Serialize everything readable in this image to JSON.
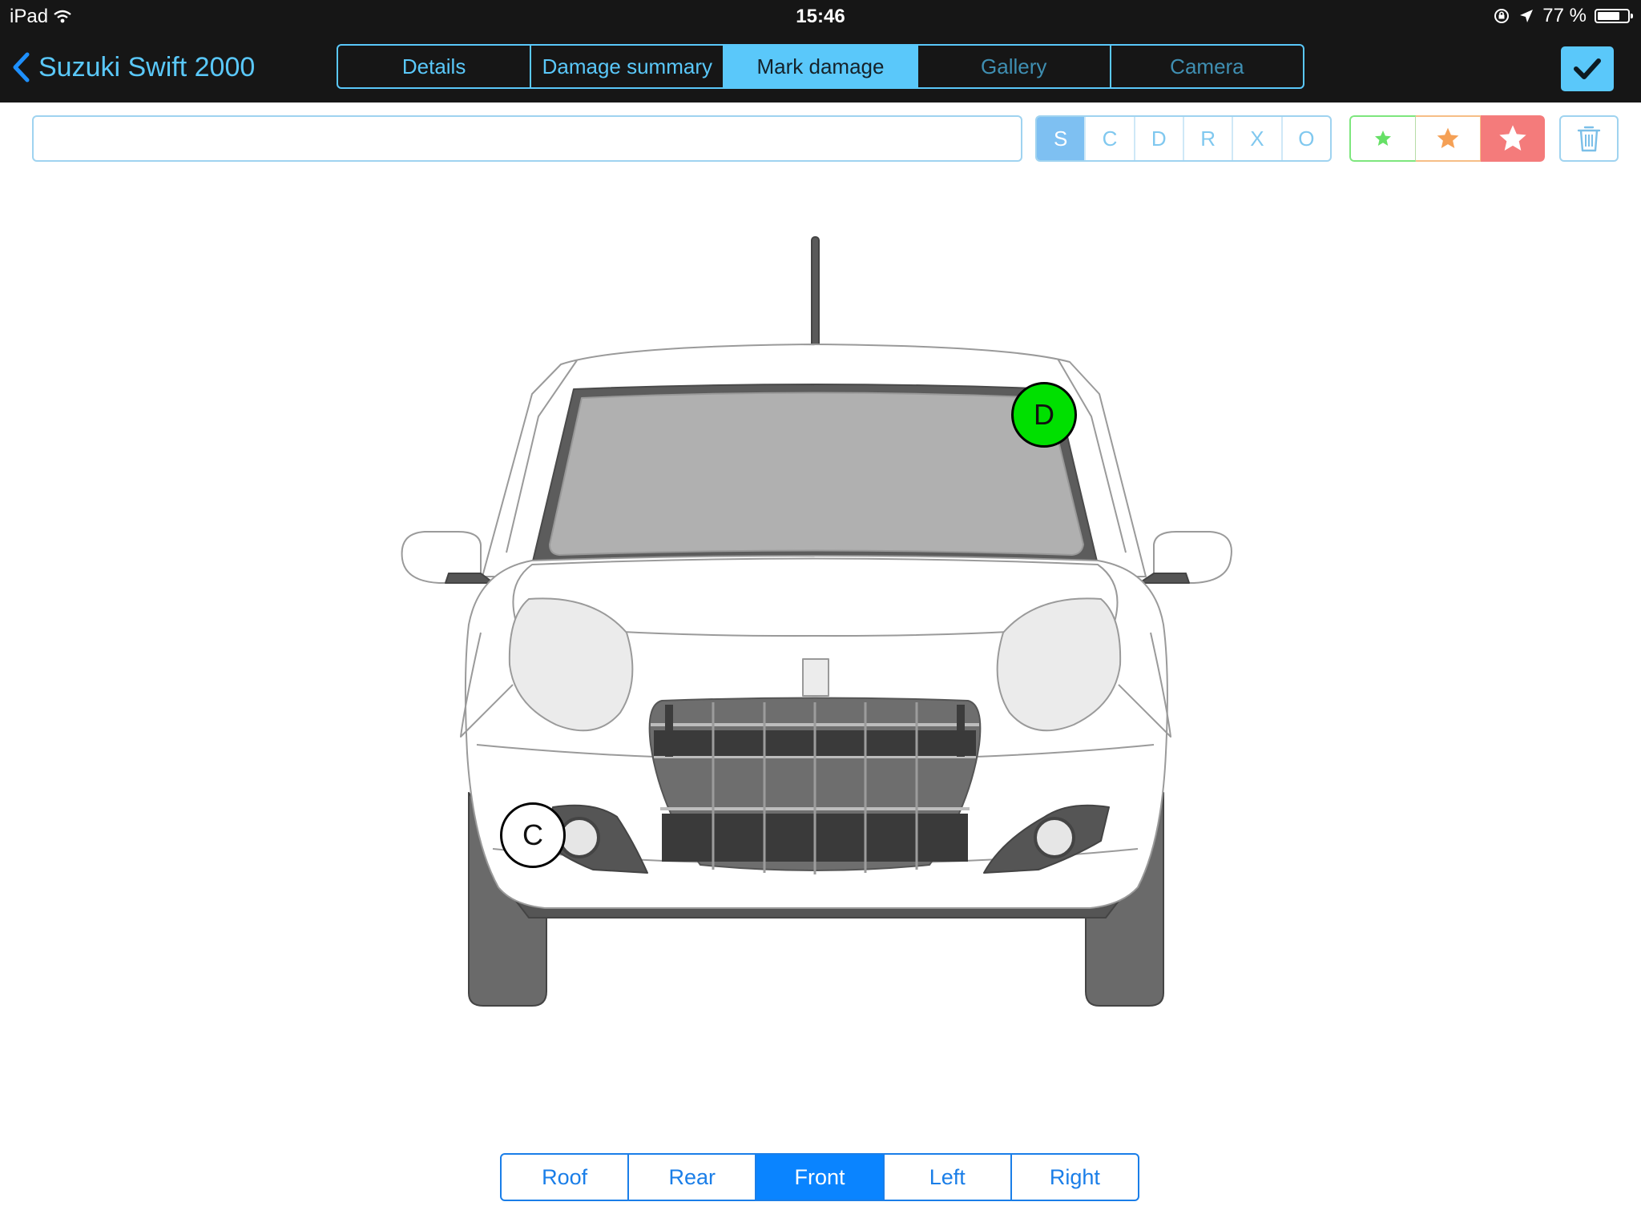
{
  "status_bar": {
    "device": "iPad",
    "time": "15:46",
    "battery": "77 %",
    "battery_level": 0.77
  },
  "nav": {
    "back_title": "Suzuki Swift 2000",
    "tabs": [
      {
        "label": "Details",
        "state": "normal"
      },
      {
        "label": "Damage summary",
        "state": "normal"
      },
      {
        "label": "Mark damage",
        "state": "selected"
      },
      {
        "label": "Gallery",
        "state": "disabled"
      },
      {
        "label": "Camera",
        "state": "disabled"
      }
    ],
    "done_icon": "checkmark-icon"
  },
  "toolbar": {
    "note_value": "",
    "damage_types": [
      "S",
      "C",
      "D",
      "R",
      "X",
      "O"
    ],
    "selected_type": "S",
    "severity": [
      {
        "level": "minor",
        "color": "#66e066"
      },
      {
        "level": "moderate",
        "color": "#f5a055"
      },
      {
        "level": "severe",
        "color": "#f47b7b"
      }
    ],
    "trash_icon": "trash-icon"
  },
  "markers": [
    {
      "label": "D",
      "fill": "#00e000"
    },
    {
      "label": "C",
      "fill": "#ffffff"
    }
  ],
  "views": [
    "Roof",
    "Rear",
    "Front",
    "Left",
    "Right"
  ],
  "selected_view": "Front",
  "colors": {
    "accent": "#5ac8fa",
    "nav_bg": "#161616",
    "view_accent": "#0a84ff"
  }
}
